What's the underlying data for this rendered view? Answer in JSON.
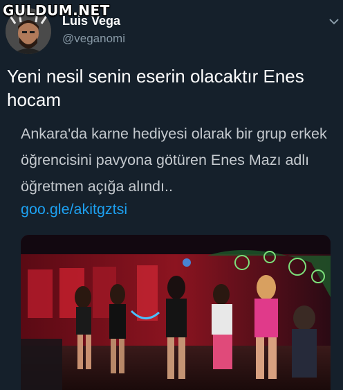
{
  "watermark": "GULDUM.NET",
  "author": {
    "display_name": "Luis Vega",
    "handle": "@veganomi"
  },
  "tweet": {
    "text": "Yeni nesil senin eserin olacaktır Enes hocam"
  },
  "quote": {
    "text": "Ankara'da karne hediyesi olarak bir grup erkek öğrencisini pavyona götüren Enes Mazı adlı öğretmen açığa alındı..",
    "link": "goo.gle/akitgztsi"
  },
  "icons": {
    "chevron": "chevron-down-icon"
  },
  "colors": {
    "background": "#15202b",
    "text": "#ffffff",
    "secondary": "#8899a6",
    "link": "#1da1f2"
  }
}
